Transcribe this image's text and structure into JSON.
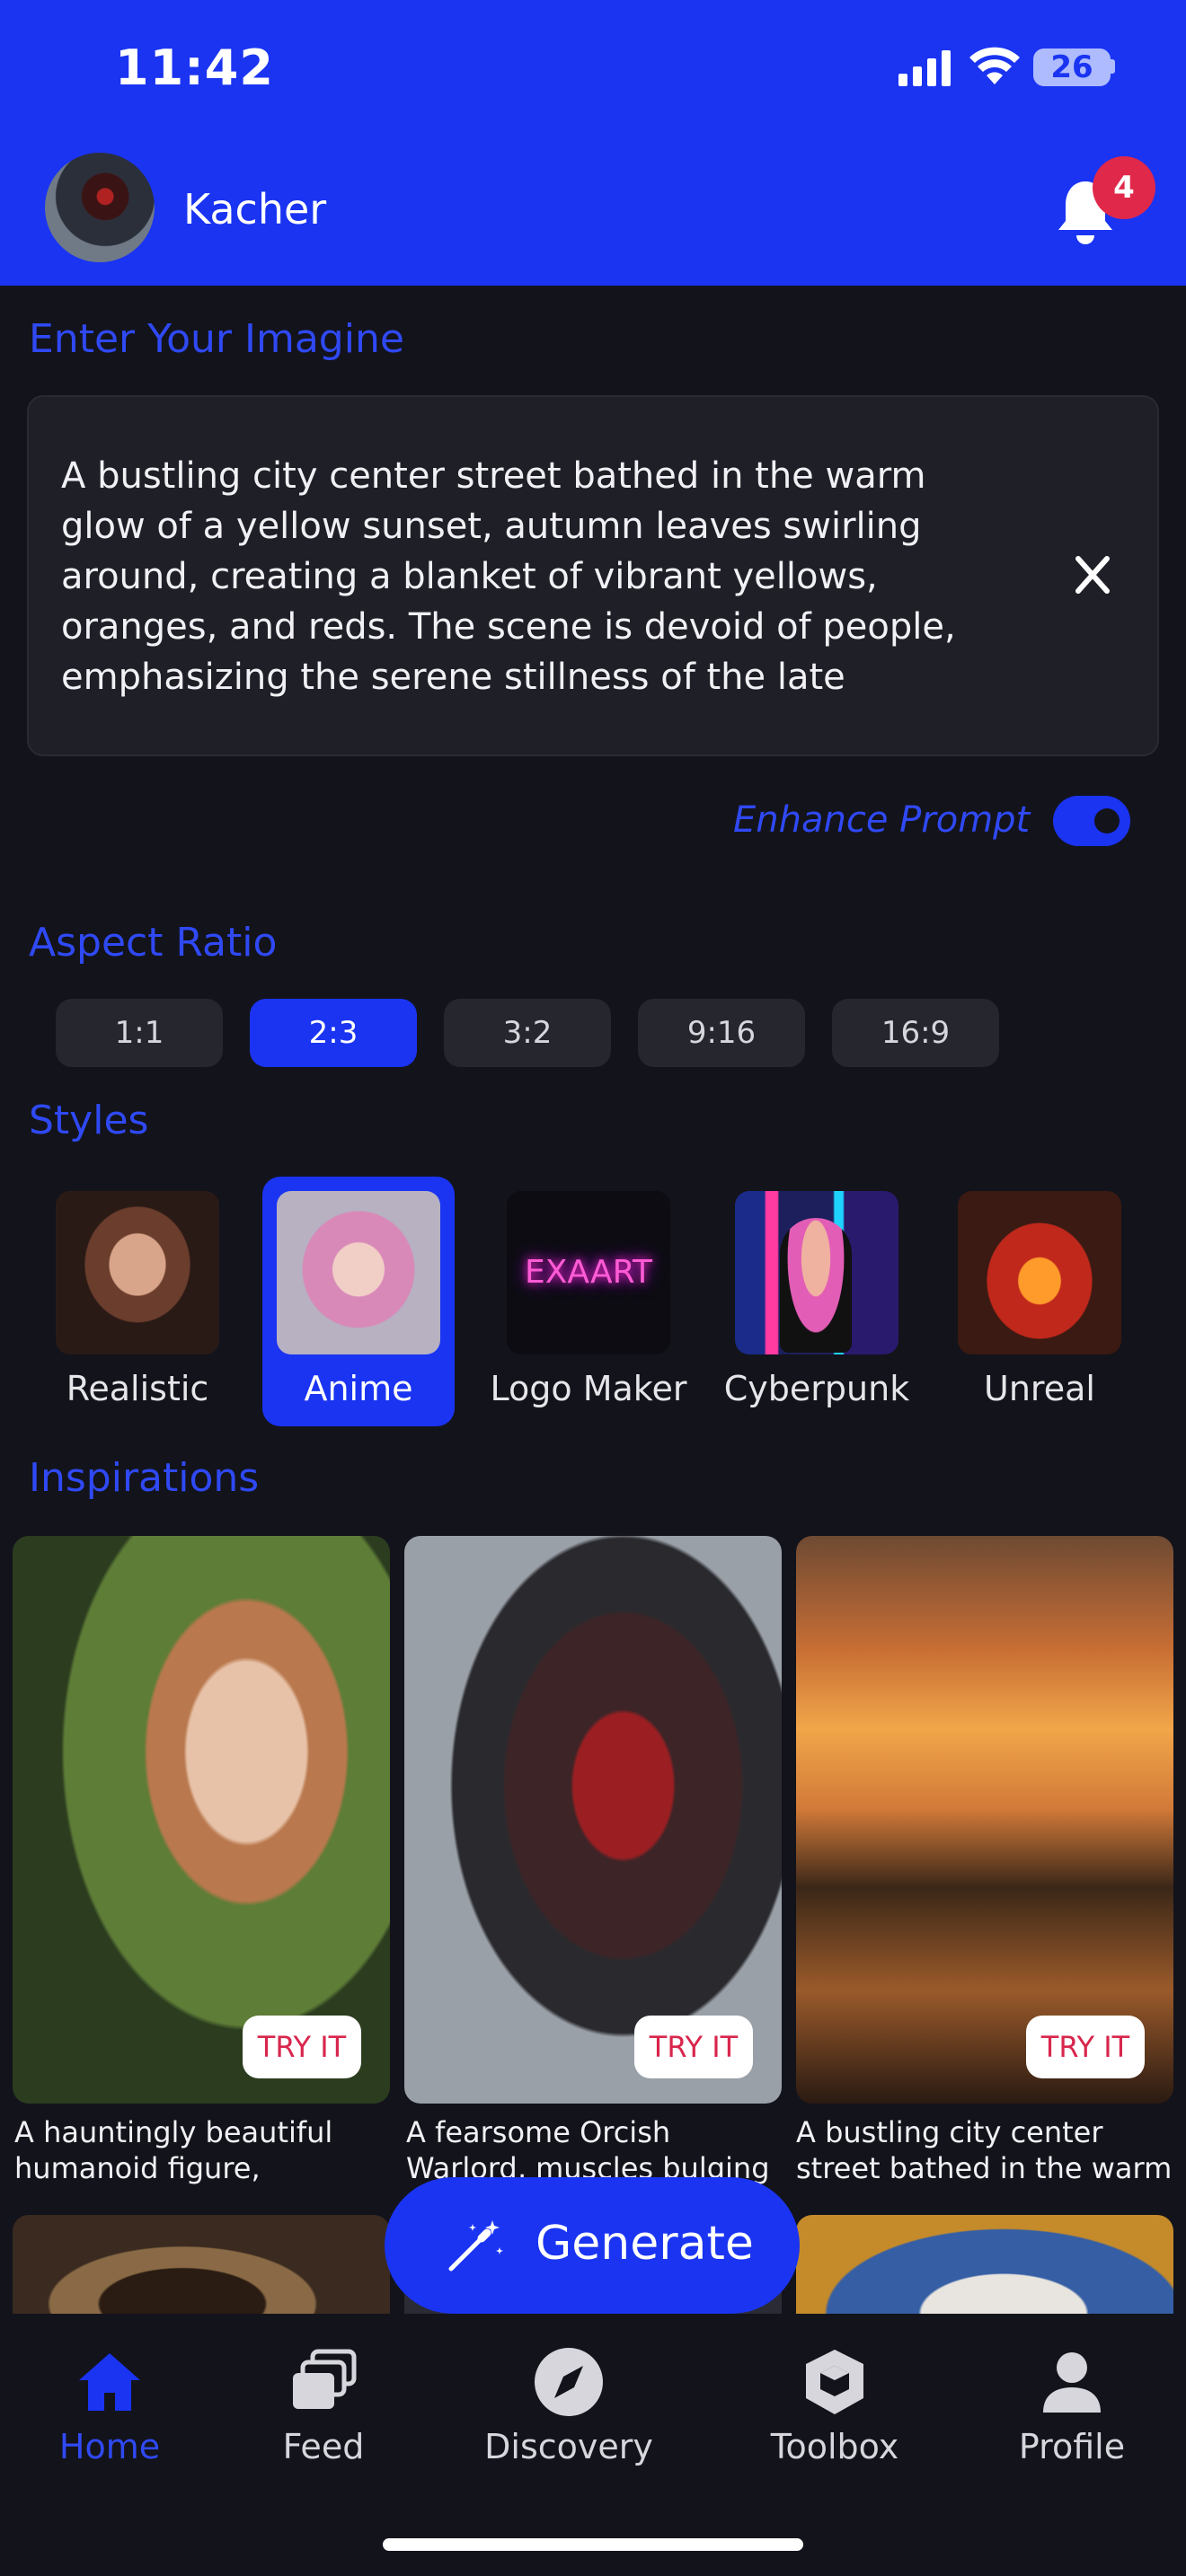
{
  "status_bar": {
    "time": "11:42",
    "battery": "26"
  },
  "header": {
    "user_name": "Kacher",
    "notification_count": "4"
  },
  "prompt": {
    "section_title": "Enter Your Imagine",
    "text": "A bustling city center street bathed in the warm glow of a yellow sunset, autumn leaves swirling around, creating a blanket of vibrant yellows, oranges, and reds. The scene is devoid of people, emphasizing the serene stillness of the late",
    "enhance_label": "Enhance Prompt",
    "enhance_enabled": true
  },
  "aspect_ratio": {
    "section_title": "Aspect Ratio",
    "options": [
      "1:1",
      "2:3",
      "3:2",
      "9:16",
      "16:9"
    ],
    "selected": "2:3"
  },
  "styles": {
    "section_title": "Styles",
    "items": [
      {
        "label": "Realistic"
      },
      {
        "label": "Anime"
      },
      {
        "label": "Logo Maker",
        "thumb_text": "EXAART"
      },
      {
        "label": "Cyberpunk"
      },
      {
        "label": "Unreal"
      }
    ],
    "selected": "Anime"
  },
  "inspirations": {
    "section_title": "Inspirations",
    "try_label": "TRY IT",
    "cards": [
      {
        "caption": "A hauntingly beautiful humanoid figure, rendered"
      },
      {
        "caption": "A fearsome Orcish Warlord, muscles bulging beneath"
      },
      {
        "caption": "A bustling city center street bathed in the warm glow of"
      }
    ]
  },
  "generate_label": "Generate",
  "bottom_nav": {
    "items": [
      {
        "label": "Home",
        "icon": "home-icon"
      },
      {
        "label": "Feed",
        "icon": "feed-icon"
      },
      {
        "label": "Discovery",
        "icon": "compass-icon"
      },
      {
        "label": "Toolbox",
        "icon": "toolbox-icon"
      },
      {
        "label": "Profile",
        "icon": "profile-icon"
      }
    ],
    "active": "Home"
  },
  "colors": {
    "accent": "#1a34f2",
    "background": "#13131b",
    "badge": "#e0284a",
    "try_text": "#d8264c"
  }
}
